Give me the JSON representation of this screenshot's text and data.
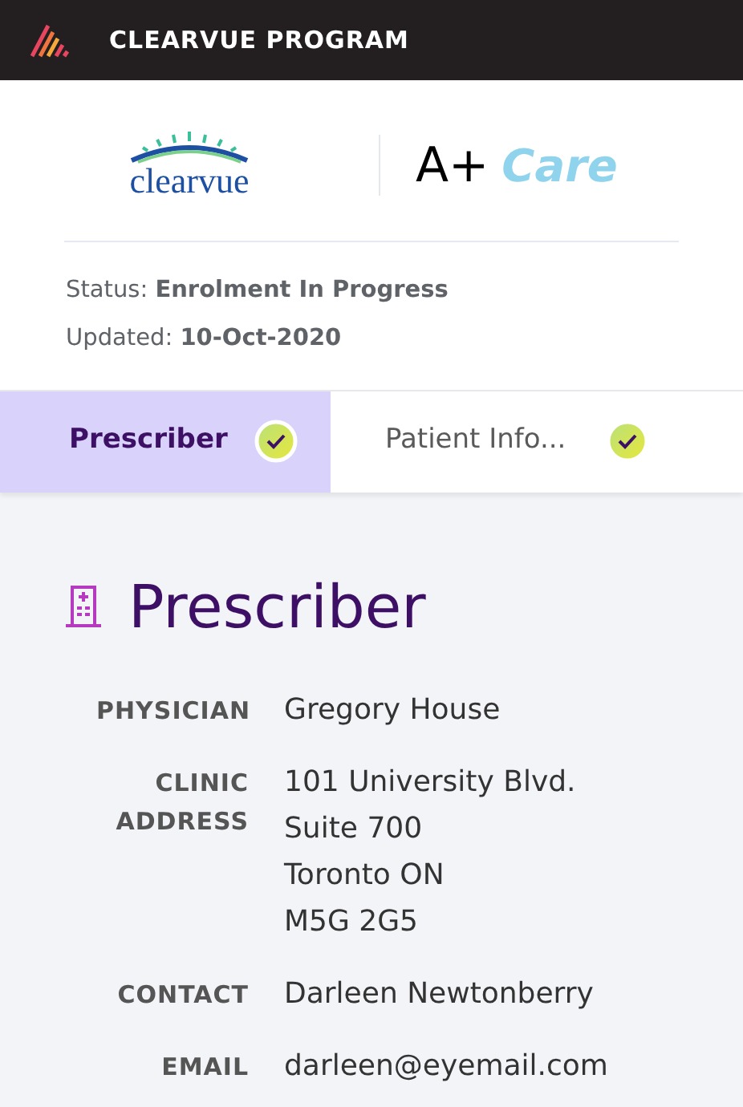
{
  "header": {
    "title": "CLEARVUE PROGRAM"
  },
  "logos": {
    "left": "clearvue",
    "right_prefix": "A+",
    "right_word": "Care"
  },
  "status": [
    "Status: **Enrolment In Progress**",
    "Updated: **10-Oct-2020**"
  ],
  "tabs": [
    {
      "label": "Prescriber",
      "selected": true,
      "complete": true
    },
    {
      "label": "Patient Info...",
      "selected": false,
      "complete": true
    }
  ],
  "section": {
    "title": "Prescriber"
  },
  "fields": [
    {
      "label": "PHYSICIAN",
      "lines": [
        "Gregory House"
      ]
    },
    {
      "label": "CLINIC ADDRESS",
      "lines": [
        "101 University Blvd.",
        "Suite 700",
        "Toronto ON",
        "M5G 2G5"
      ]
    },
    {
      "label": "CONTACT",
      "lines": [
        "Darleen Newtonberry"
      ]
    },
    {
      "label": "EMAIL",
      "lines": [
        "darleen@eyemail.com"
      ]
    }
  ]
}
